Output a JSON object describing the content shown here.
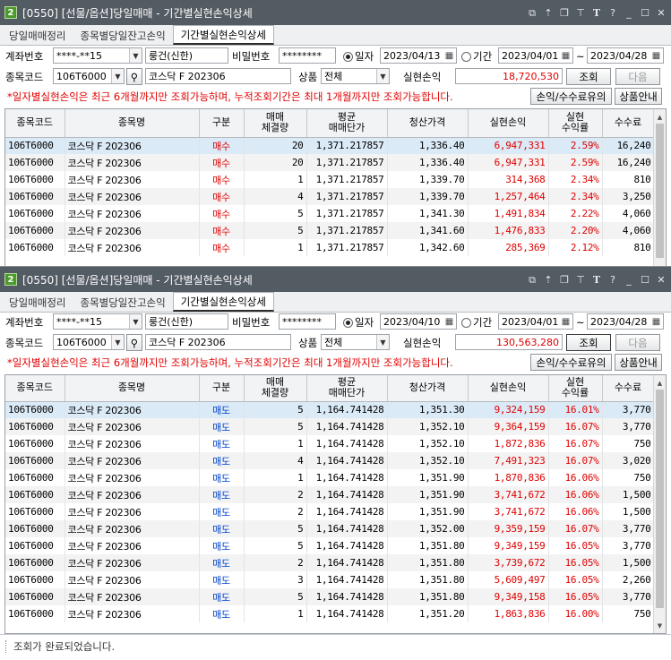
{
  "windows": [
    {
      "title": "[0550] [선물/옵션]당일매매 - 기간별실현손익상세",
      "window_number": "2",
      "tabs": [
        "당일매매정리",
        "종목별당일잔고손익",
        "기간별실현손익상세"
      ],
      "active_tab": 2,
      "form": {
        "account_label": "계좌번호",
        "account_value": "****-**15",
        "account_name": "룽건(신한)",
        "password_label": "비밀번호",
        "password_value": "********",
        "date_radio_label": "일자",
        "date_value": "2023/04/13",
        "period_radio_label": "기간",
        "period_start": "2023/04/01",
        "tilde": "~",
        "period_end": "2023/04/28",
        "code_label": "종목코드",
        "code_value": "106T6000",
        "code_name": "코스닥 F 202306",
        "product_label": "상품",
        "product_value": "전체",
        "realized_label": "실현손익",
        "realized_value": "18,720,530",
        "query_button": "조회",
        "next_button": "다음",
        "notice": "*일자별실현손익은 최근 6개월까지만 조회가능하며, 누적조회기간은 최대 1개월까지만 조회가능합니다.",
        "fee_button": "손익/수수료유의",
        "product_guide_button": "상품안내"
      },
      "table": {
        "headers": [
          "종목코드",
          "종목명",
          "구분",
          "매매\n체결량",
          "평균\n매매단가",
          "청산가격",
          "실현손익",
          "실현\n수익률",
          "수수료"
        ],
        "rows": [
          [
            "106T6000",
            "코스닥 F 202306",
            "매수",
            "20",
            "1,371.217857",
            "1,336.40",
            "6,947,331",
            "2.59%",
            "16,240"
          ],
          [
            "106T6000",
            "코스닥 F 202306",
            "매수",
            "20",
            "1,371.217857",
            "1,336.40",
            "6,947,331",
            "2.59%",
            "16,240"
          ],
          [
            "106T6000",
            "코스닥 F 202306",
            "매수",
            "1",
            "1,371.217857",
            "1,339.70",
            "314,368",
            "2.34%",
            "810"
          ],
          [
            "106T6000",
            "코스닥 F 202306",
            "매수",
            "4",
            "1,371.217857",
            "1,339.70",
            "1,257,464",
            "2.34%",
            "3,250"
          ],
          [
            "106T6000",
            "코스닥 F 202306",
            "매수",
            "5",
            "1,371.217857",
            "1,341.30",
            "1,491,834",
            "2.22%",
            "4,060"
          ],
          [
            "106T6000",
            "코스닥 F 202306",
            "매수",
            "5",
            "1,371.217857",
            "1,341.60",
            "1,476,833",
            "2.20%",
            "4,060"
          ],
          [
            "106T6000",
            "코스닥 F 202306",
            "매수",
            "1",
            "1,371.217857",
            "1,342.60",
            "285,369",
            "2.12%",
            "810"
          ]
        ]
      }
    },
    {
      "title": "[0550] [선물/옵션]당일매매 - 기간별실현손익상세",
      "window_number": "2",
      "tabs": [
        "당일매매정리",
        "종목별당일잔고손익",
        "기간별실현손익상세"
      ],
      "active_tab": 2,
      "form": {
        "account_label": "계좌번호",
        "account_value": "****-**15",
        "account_name": "룽건(신한)",
        "password_label": "비밀번호",
        "password_value": "********",
        "date_radio_label": "일자",
        "date_value": "2023/04/10",
        "period_radio_label": "기간",
        "period_start": "2023/04/01",
        "tilde": "~",
        "period_end": "2023/04/28",
        "code_label": "종목코드",
        "code_value": "106T6000",
        "code_name": "코스닥 F 202306",
        "product_label": "상품",
        "product_value": "전체",
        "realized_label": "실현손익",
        "realized_value": "130,563,280",
        "query_button": "조회",
        "next_button": "다음",
        "notice": "*일자별실현손익은 최근 6개월까지만 조회가능하며, 누적조회기간은 최대 1개월까지만 조회가능합니다.",
        "fee_button": "손익/수수료유의",
        "product_guide_button": "상품안내"
      },
      "table": {
        "headers": [
          "종목코드",
          "종목명",
          "구분",
          "매매\n체결량",
          "평균\n매매단가",
          "청산가격",
          "실현손익",
          "실현\n수익률",
          "수수료"
        ],
        "rows": [
          [
            "106T6000",
            "코스닥 F 202306",
            "매도",
            "5",
            "1,164.741428",
            "1,351.30",
            "9,324,159",
            "16.01%",
            "3,770"
          ],
          [
            "106T6000",
            "코스닥 F 202306",
            "매도",
            "5",
            "1,164.741428",
            "1,352.10",
            "9,364,159",
            "16.07%",
            "3,770"
          ],
          [
            "106T6000",
            "코스닥 F 202306",
            "매도",
            "1",
            "1,164.741428",
            "1,352.10",
            "1,872,836",
            "16.07%",
            "750"
          ],
          [
            "106T6000",
            "코스닥 F 202306",
            "매도",
            "4",
            "1,164.741428",
            "1,352.10",
            "7,491,323",
            "16.07%",
            "3,020"
          ],
          [
            "106T6000",
            "코스닥 F 202306",
            "매도",
            "1",
            "1,164.741428",
            "1,351.90",
            "1,870,836",
            "16.06%",
            "750"
          ],
          [
            "106T6000",
            "코스닥 F 202306",
            "매도",
            "2",
            "1,164.741428",
            "1,351.90",
            "3,741,672",
            "16.06%",
            "1,500"
          ],
          [
            "106T6000",
            "코스닥 F 202306",
            "매도",
            "2",
            "1,164.741428",
            "1,351.90",
            "3,741,672",
            "16.06%",
            "1,500"
          ],
          [
            "106T6000",
            "코스닥 F 202306",
            "매도",
            "5",
            "1,164.741428",
            "1,352.00",
            "9,359,159",
            "16.07%",
            "3,770"
          ],
          [
            "106T6000",
            "코스닥 F 202306",
            "매도",
            "5",
            "1,164.741428",
            "1,351.80",
            "9,349,159",
            "16.05%",
            "3,770"
          ],
          [
            "106T6000",
            "코스닥 F 202306",
            "매도",
            "2",
            "1,164.741428",
            "1,351.80",
            "3,739,672",
            "16.05%",
            "1,500"
          ],
          [
            "106T6000",
            "코스닥 F 202306",
            "매도",
            "3",
            "1,164.741428",
            "1,351.80",
            "5,609,497",
            "16.05%",
            "2,260"
          ],
          [
            "106T6000",
            "코스닥 F 202306",
            "매도",
            "5",
            "1,164.741428",
            "1,351.80",
            "9,349,158",
            "16.05%",
            "3,770"
          ],
          [
            "106T6000",
            "코스닥 F 202306",
            "매도",
            "1",
            "1,164.741428",
            "1,351.20",
            "1,863,836",
            "16.00%",
            "750"
          ]
        ]
      },
      "status": "조회가 완료되었습니다."
    }
  ],
  "icons": {
    "title_buttons": [
      "link-icon",
      "pin-icon",
      "copy-icon",
      "pushpin-icon",
      "font-icon",
      "help-icon",
      "minimize-icon",
      "maximize-icon",
      "close-icon"
    ],
    "combo": "chevron-down-icon",
    "calendar": "calendar-icon",
    "search": "search-icon"
  },
  "colors": {
    "titlebar": "#535b63",
    "buy": "#e00000",
    "sell": "#0044cc",
    "profit": "#e00000",
    "selected_row": "#dbeaf7"
  }
}
